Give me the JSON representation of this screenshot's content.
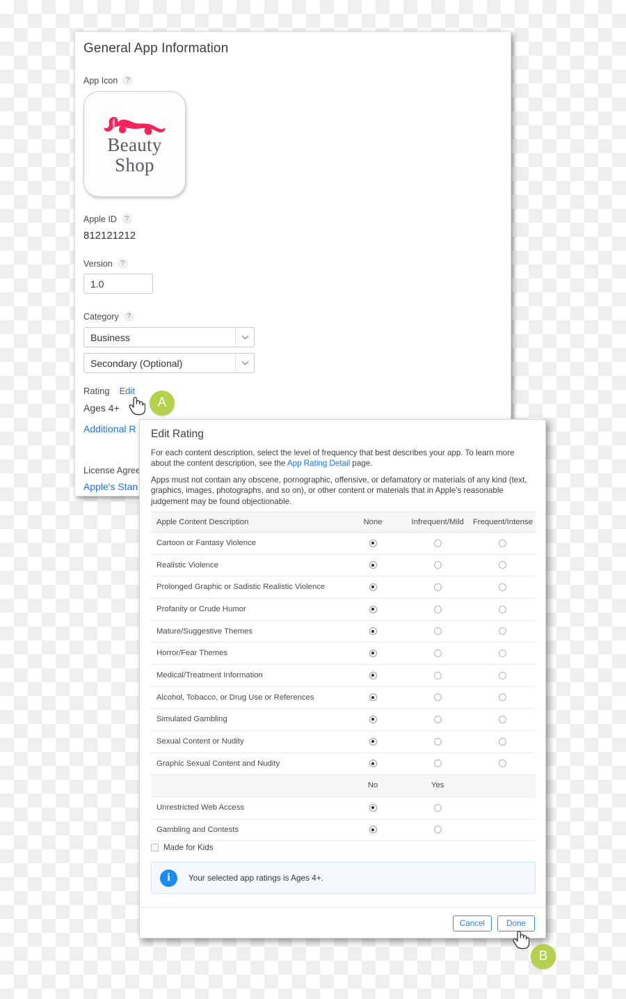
{
  "main_card": {
    "page_title": "General App Information",
    "app_icon": {
      "label": "App Icon",
      "help": "?",
      "logo_line1": "Beauty",
      "logo_line2": "Shop",
      "logo_color": "#f4235c"
    },
    "apple_id": {
      "label": "Apple ID",
      "help": "?",
      "value": "812121212"
    },
    "version": {
      "label": "Version",
      "help": "?",
      "value": "1.0"
    },
    "category": {
      "label": "Category",
      "help": "?",
      "primary_value": "Business",
      "secondary_value": "Secondary (Optional)",
      "chevron_icon": "chevron-down-icon"
    },
    "rating": {
      "label": "Rating",
      "edit_link": "Edit",
      "value": "Ages 4+",
      "additional_link": "Additional R"
    },
    "license": {
      "label": "License Agree",
      "link": "Apple's Stan"
    }
  },
  "dialog": {
    "title": "Edit Rating",
    "paragraph_1": "For each content description, select the level of frequency that best describes your app. To learn more about the content description, see the App Rating Detail page.",
    "paragraph_1_pre": "For each content description, select the level of frequency that best describes your app. To learn more about the content description, see the ",
    "paragraph_1_link": "App Rating Detail",
    "paragraph_1_post": " page.",
    "paragraph_2": "Apps must not contain any obscene, pornographic, offensive, or defamatory or materials of any kind (text, graphics, images, photographs, and so on), or other content or materials that in Apple's reasonable judgement may be found objectionable.",
    "table": {
      "headers": [
        "Apple Content Description",
        "None",
        "Infrequent/Mild",
        "Frequent/Intense"
      ],
      "rows": [
        {
          "label": "Cartoon or Fantasy Violence",
          "selected": 0
        },
        {
          "label": "Realistic Violence",
          "selected": 0
        },
        {
          "label": "Prolonged Graphic or Sadistic Realistic Violence",
          "selected": 0
        },
        {
          "label": "Profanity or Crude Humor",
          "selected": 0
        },
        {
          "label": "Mature/Suggestive Themes",
          "selected": 0
        },
        {
          "label": "Horror/Fear Themes",
          "selected": 0
        },
        {
          "label": "Medical/Treatment Information",
          "selected": 0
        },
        {
          "label": "Alcohol, Tobacco, or Drug Use or References",
          "selected": 0
        },
        {
          "label": "Simulated Gambling",
          "selected": 0
        },
        {
          "label": "Sexual Content or Nudity",
          "selected": 0
        },
        {
          "label": "Graphic Sexual Content and Nudity",
          "selected": 0
        }
      ],
      "subheaders": [
        "",
        "No",
        "Yes"
      ],
      "yesno_rows": [
        {
          "label": "Unrestricted Web Access",
          "selected": 0
        },
        {
          "label": "Gambling and Contests",
          "selected": 0
        }
      ]
    },
    "made_for_kids": {
      "label": "Made for Kids",
      "checked": false
    },
    "info_banner": {
      "icon": "info-icon",
      "text": "Your selected app ratings is Ages 4+."
    },
    "footer": {
      "cancel_label": "Cancel",
      "done_label": "Done"
    }
  },
  "annotations": {
    "badge_a": "A",
    "badge_b": "B",
    "badge_color": "#b5d04a",
    "cursor_a": "pointer-hand-cursor",
    "cursor_b": "pointer-hand-cursor"
  }
}
